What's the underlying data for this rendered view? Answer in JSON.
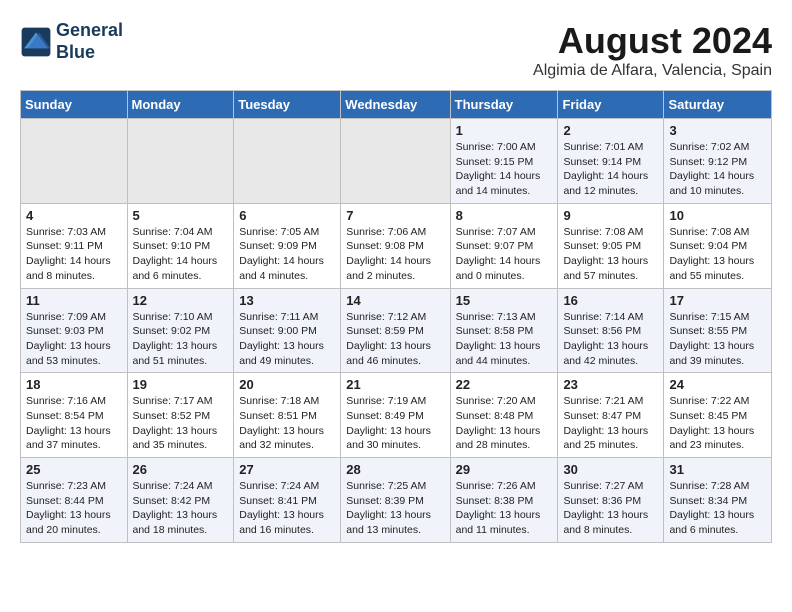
{
  "logo": {
    "line1": "General",
    "line2": "Blue"
  },
  "title": "August 2024",
  "location": "Algimia de Alfara, Valencia, Spain",
  "days_of_week": [
    "Sunday",
    "Monday",
    "Tuesday",
    "Wednesday",
    "Thursday",
    "Friday",
    "Saturday"
  ],
  "weeks": [
    [
      {
        "day": "",
        "info": ""
      },
      {
        "day": "",
        "info": ""
      },
      {
        "day": "",
        "info": ""
      },
      {
        "day": "",
        "info": ""
      },
      {
        "day": "1",
        "info": "Sunrise: 7:00 AM\nSunset: 9:15 PM\nDaylight: 14 hours\nand 14 minutes."
      },
      {
        "day": "2",
        "info": "Sunrise: 7:01 AM\nSunset: 9:14 PM\nDaylight: 14 hours\nand 12 minutes."
      },
      {
        "day": "3",
        "info": "Sunrise: 7:02 AM\nSunset: 9:12 PM\nDaylight: 14 hours\nand 10 minutes."
      }
    ],
    [
      {
        "day": "4",
        "info": "Sunrise: 7:03 AM\nSunset: 9:11 PM\nDaylight: 14 hours\nand 8 minutes."
      },
      {
        "day": "5",
        "info": "Sunrise: 7:04 AM\nSunset: 9:10 PM\nDaylight: 14 hours\nand 6 minutes."
      },
      {
        "day": "6",
        "info": "Sunrise: 7:05 AM\nSunset: 9:09 PM\nDaylight: 14 hours\nand 4 minutes."
      },
      {
        "day": "7",
        "info": "Sunrise: 7:06 AM\nSunset: 9:08 PM\nDaylight: 14 hours\nand 2 minutes."
      },
      {
        "day": "8",
        "info": "Sunrise: 7:07 AM\nSunset: 9:07 PM\nDaylight: 14 hours\nand 0 minutes."
      },
      {
        "day": "9",
        "info": "Sunrise: 7:08 AM\nSunset: 9:05 PM\nDaylight: 13 hours\nand 57 minutes."
      },
      {
        "day": "10",
        "info": "Sunrise: 7:08 AM\nSunset: 9:04 PM\nDaylight: 13 hours\nand 55 minutes."
      }
    ],
    [
      {
        "day": "11",
        "info": "Sunrise: 7:09 AM\nSunset: 9:03 PM\nDaylight: 13 hours\nand 53 minutes."
      },
      {
        "day": "12",
        "info": "Sunrise: 7:10 AM\nSunset: 9:02 PM\nDaylight: 13 hours\nand 51 minutes."
      },
      {
        "day": "13",
        "info": "Sunrise: 7:11 AM\nSunset: 9:00 PM\nDaylight: 13 hours\nand 49 minutes."
      },
      {
        "day": "14",
        "info": "Sunrise: 7:12 AM\nSunset: 8:59 PM\nDaylight: 13 hours\nand 46 minutes."
      },
      {
        "day": "15",
        "info": "Sunrise: 7:13 AM\nSunset: 8:58 PM\nDaylight: 13 hours\nand 44 minutes."
      },
      {
        "day": "16",
        "info": "Sunrise: 7:14 AM\nSunset: 8:56 PM\nDaylight: 13 hours\nand 42 minutes."
      },
      {
        "day": "17",
        "info": "Sunrise: 7:15 AM\nSunset: 8:55 PM\nDaylight: 13 hours\nand 39 minutes."
      }
    ],
    [
      {
        "day": "18",
        "info": "Sunrise: 7:16 AM\nSunset: 8:54 PM\nDaylight: 13 hours\nand 37 minutes."
      },
      {
        "day": "19",
        "info": "Sunrise: 7:17 AM\nSunset: 8:52 PM\nDaylight: 13 hours\nand 35 minutes."
      },
      {
        "day": "20",
        "info": "Sunrise: 7:18 AM\nSunset: 8:51 PM\nDaylight: 13 hours\nand 32 minutes."
      },
      {
        "day": "21",
        "info": "Sunrise: 7:19 AM\nSunset: 8:49 PM\nDaylight: 13 hours\nand 30 minutes."
      },
      {
        "day": "22",
        "info": "Sunrise: 7:20 AM\nSunset: 8:48 PM\nDaylight: 13 hours\nand 28 minutes."
      },
      {
        "day": "23",
        "info": "Sunrise: 7:21 AM\nSunset: 8:47 PM\nDaylight: 13 hours\nand 25 minutes."
      },
      {
        "day": "24",
        "info": "Sunrise: 7:22 AM\nSunset: 8:45 PM\nDaylight: 13 hours\nand 23 minutes."
      }
    ],
    [
      {
        "day": "25",
        "info": "Sunrise: 7:23 AM\nSunset: 8:44 PM\nDaylight: 13 hours\nand 20 minutes."
      },
      {
        "day": "26",
        "info": "Sunrise: 7:24 AM\nSunset: 8:42 PM\nDaylight: 13 hours\nand 18 minutes."
      },
      {
        "day": "27",
        "info": "Sunrise: 7:24 AM\nSunset: 8:41 PM\nDaylight: 13 hours\nand 16 minutes."
      },
      {
        "day": "28",
        "info": "Sunrise: 7:25 AM\nSunset: 8:39 PM\nDaylight: 13 hours\nand 13 minutes."
      },
      {
        "day": "29",
        "info": "Sunrise: 7:26 AM\nSunset: 8:38 PM\nDaylight: 13 hours\nand 11 minutes."
      },
      {
        "day": "30",
        "info": "Sunrise: 7:27 AM\nSunset: 8:36 PM\nDaylight: 13 hours\nand 8 minutes."
      },
      {
        "day": "31",
        "info": "Sunrise: 7:28 AM\nSunset: 8:34 PM\nDaylight: 13 hours\nand 6 minutes."
      }
    ]
  ]
}
